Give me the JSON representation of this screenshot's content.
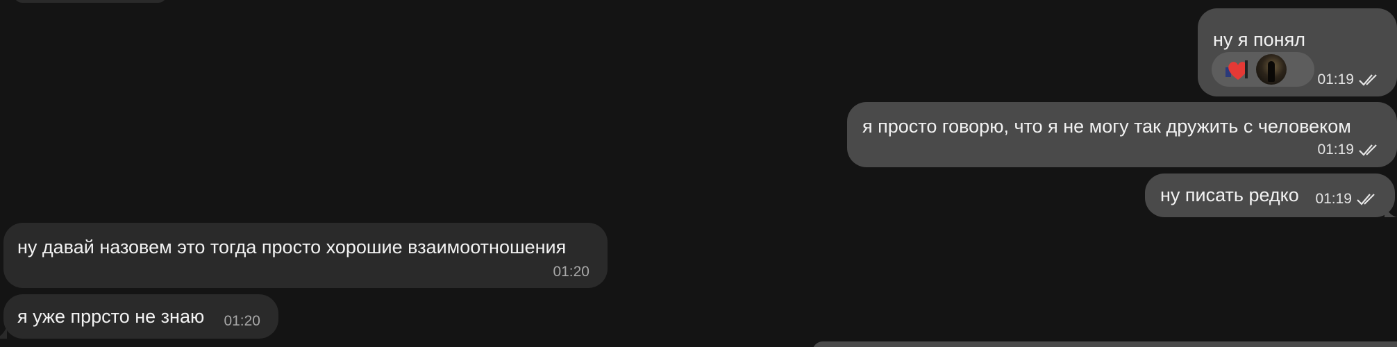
{
  "messages": [
    {
      "direction": "outgoing",
      "text": "ну я понял",
      "time": "01:19",
      "read": true,
      "reactions": [
        "heart-reaction",
        "avatar-reaction"
      ]
    },
    {
      "direction": "outgoing",
      "text": "я просто говорю, что я не могу так дружить с человеком",
      "time": "01:19",
      "read": true
    },
    {
      "direction": "outgoing",
      "text": "ну писать редко",
      "time": "01:19",
      "read": true
    },
    {
      "direction": "incoming",
      "text": "ну давай назовем это тогда просто хорошие взаимоотношения",
      "time": "01:20"
    },
    {
      "direction": "incoming",
      "text": "я уже пррсто не знаю",
      "time": "01:20"
    }
  ],
  "colors": {
    "background": "#141414",
    "outgoing_bubble": "#4a4a4a",
    "incoming_bubble": "#2a2a2a",
    "reaction_pill": "#5d5d5d",
    "heart": "#e53935"
  }
}
